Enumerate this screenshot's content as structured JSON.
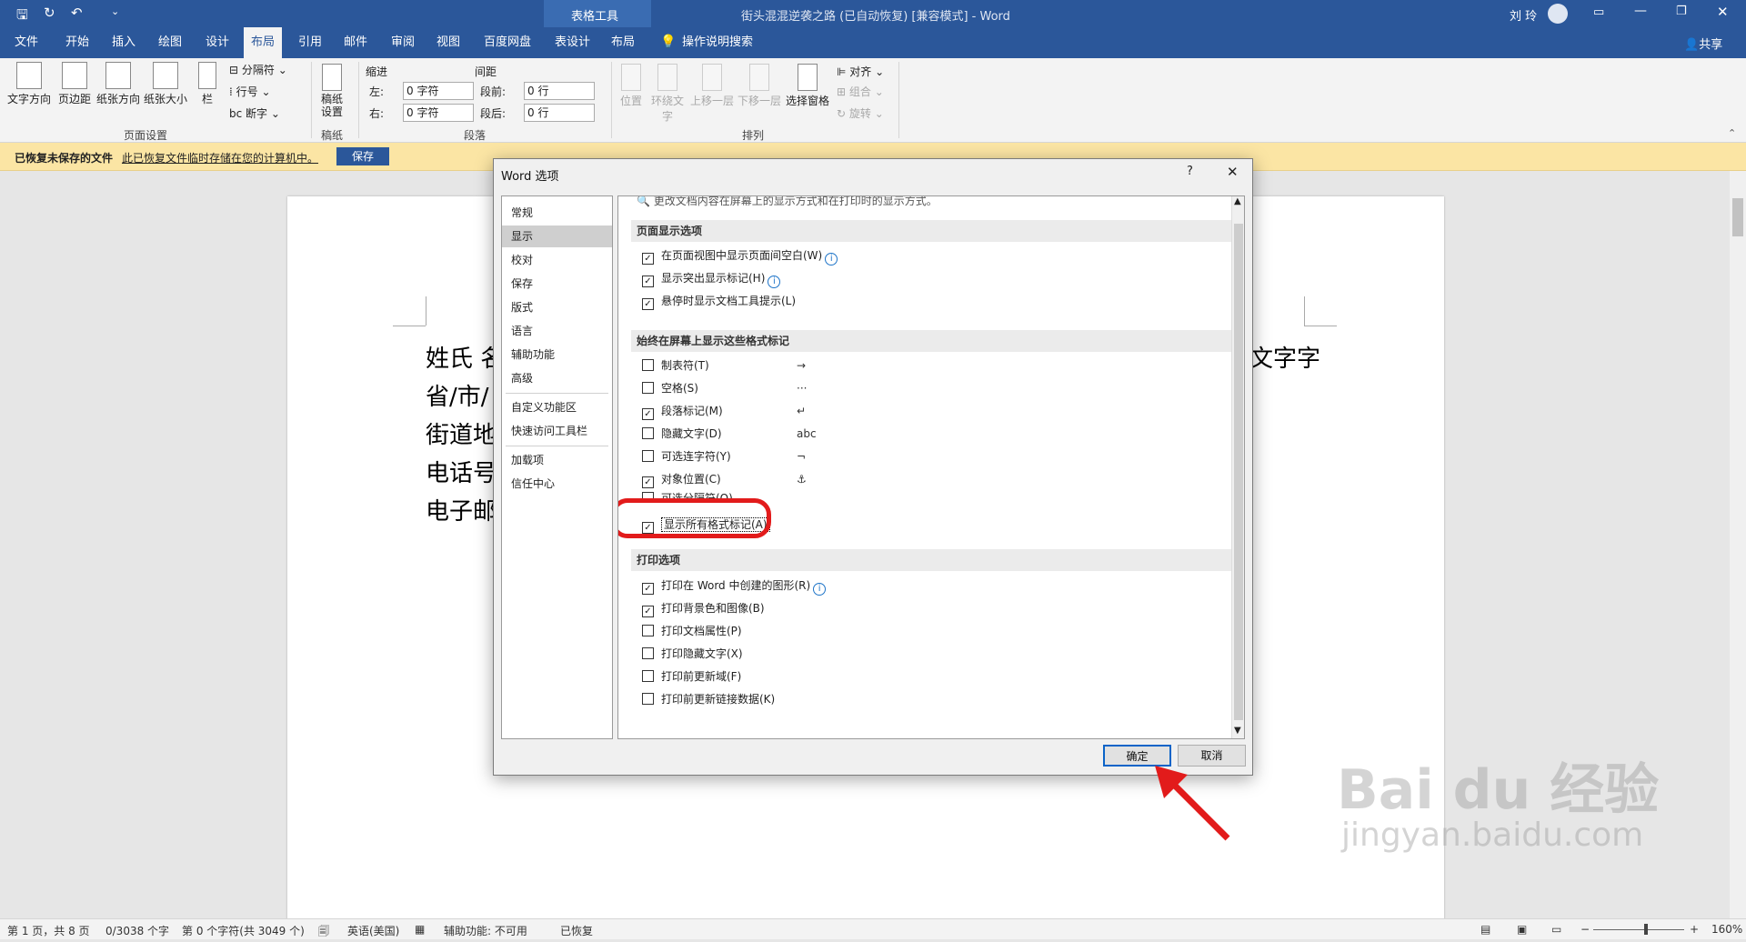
{
  "title_bar": {
    "context_tab_group": "表格工具",
    "document_title": "街头混混逆袭之路 (已自动恢复) [兼容模式]  -  Word",
    "user_name": "刘 玲"
  },
  "tabs": [
    "文件",
    "开始",
    "插入",
    "绘图",
    "设计",
    "布局",
    "引用",
    "邮件",
    "审阅",
    "视图",
    "百度网盘",
    "表设计",
    "布局"
  ],
  "active_tab_index": 5,
  "tell_me": "操作说明搜索",
  "share": "共享",
  "ribbon": {
    "page_setup": {
      "label": "页面设置",
      "buttons": [
        "文字方向",
        "页边距",
        "纸张方向",
        "纸张大小",
        "栏"
      ],
      "small": [
        "分隔符",
        "行号",
        "断字"
      ]
    },
    "manuscript": {
      "label": "稿纸",
      "button": "稿纸\n设置"
    },
    "paragraph": {
      "label": "段落",
      "indent": "缩进",
      "spacing": "间距",
      "left": "左:",
      "right": "右:",
      "before": "段前:",
      "after": "段后:",
      "left_val": "0 字符",
      "right_val": "0 字符",
      "before_val": "0 行",
      "after_val": "0 行"
    },
    "arrange": {
      "label": "排列",
      "buttons": [
        "位置",
        "环绕文字",
        "上移一层",
        "下移一层",
        "选择窗格"
      ],
      "small": [
        "对齐",
        "组合",
        "旋转"
      ]
    }
  },
  "infobar": {
    "title": "已恢复未保存的文件",
    "message": "此已恢复文件临时存储在您的计算机中。",
    "button": "保存"
  },
  "document": {
    "lines": [
      "姓氏 名",
      "省/市/",
      "街道地",
      "电话号",
      "电子邮"
    ],
    "right_fragment": "文字字"
  },
  "dialog": {
    "title": "Word 选项",
    "help": "?",
    "close": "✕",
    "nav": [
      "常规",
      "显示",
      "校对",
      "保存",
      "版式",
      "语言",
      "辅助功能",
      "高级",
      "自定义功能区",
      "快速访问工具栏",
      "加载项",
      "信任中心"
    ],
    "selected_nav": 1,
    "intro": "更改文档内容在屏幕上的显示方式和在打印时的显示方式。",
    "sections": {
      "page_display": "页面显示选项",
      "format_marks": "始终在屏幕上显示这些格式标记",
      "print": "打印选项"
    },
    "page_display_options": [
      {
        "label": "在页面视图中显示页面间空白(W)",
        "checked": true,
        "info": true
      },
      {
        "label": "显示突出显示标记(H)",
        "checked": true,
        "info": true
      },
      {
        "label": "悬停时显示文档工具提示(L)",
        "checked": true,
        "info": false
      }
    ],
    "format_mark_options": [
      {
        "label": "制表符(T)",
        "checked": false,
        "symbol": "→"
      },
      {
        "label": "空格(S)",
        "checked": false,
        "symbol": "···"
      },
      {
        "label": "段落标记(M)",
        "checked": true,
        "symbol": "↵"
      },
      {
        "label": "隐藏文字(D)",
        "checked": false,
        "symbol": "abc"
      },
      {
        "label": "可选连字符(Y)",
        "checked": false,
        "symbol": "¬"
      },
      {
        "label": "对象位置(C)",
        "checked": true,
        "symbol": "⚓"
      },
      {
        "label": "可选分隔符(O)",
        "checked": false,
        "symbol": "▯"
      },
      {
        "label": "显示所有格式标记(A)",
        "checked": true,
        "symbol": ""
      }
    ],
    "print_options": [
      {
        "label": "打印在 Word 中创建的图形(R)",
        "checked": true,
        "info": true
      },
      {
        "label": "打印背景色和图像(B)",
        "checked": true,
        "info": false
      },
      {
        "label": "打印文档属性(P)",
        "checked": false,
        "info": false
      },
      {
        "label": "打印隐藏文字(X)",
        "checked": false,
        "info": false
      },
      {
        "label": "打印前更新域(F)",
        "checked": false,
        "info": false
      },
      {
        "label": "打印前更新链接数据(K)",
        "checked": false,
        "info": false
      }
    ],
    "ok": "确定",
    "cancel": "取消"
  },
  "status_bar": {
    "page": "第 1 页，共 8 页",
    "words": "0/3038 个字",
    "chars": "第 0 个字符(共 3049 个)",
    "language": "英语(美国)",
    "accessibility": "辅助功能: 不可用",
    "recovered": "已恢复",
    "zoom": "160%"
  },
  "watermark": {
    "brand": "Bai du 经验",
    "url": "jingyan.baidu.com"
  }
}
